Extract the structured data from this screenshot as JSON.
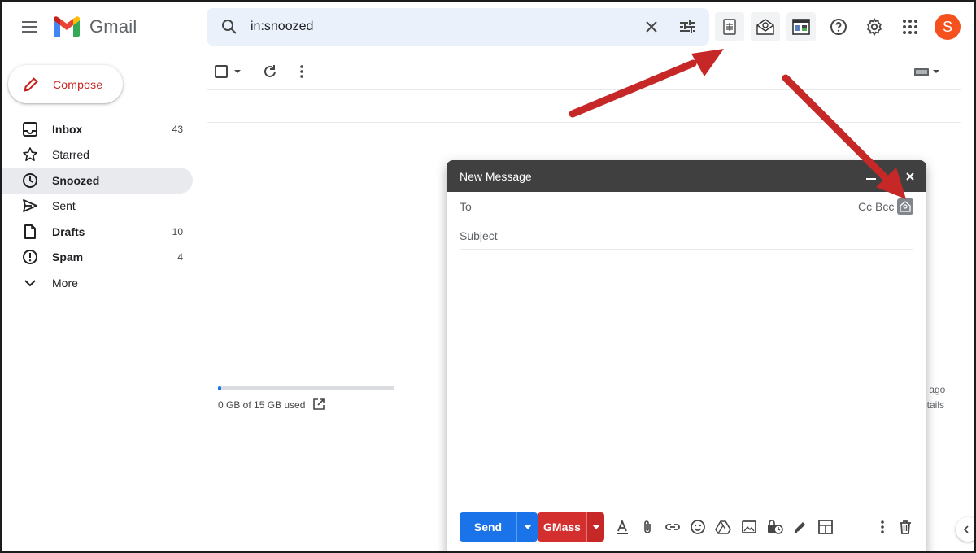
{
  "app": {
    "name": "Gmail"
  },
  "search": {
    "query": "in:snoozed"
  },
  "compose_button": {
    "label": "Compose"
  },
  "nav": [
    {
      "label": "Inbox",
      "count": "43",
      "icon": "inbox-icon",
      "bold": true
    },
    {
      "label": "Starred",
      "count": "",
      "icon": "star-icon",
      "bold": false
    },
    {
      "label": "Snoozed",
      "count": "",
      "icon": "clock-icon",
      "bold": true,
      "active": true
    },
    {
      "label": "Sent",
      "count": "",
      "icon": "send-icon",
      "bold": false
    },
    {
      "label": "Drafts",
      "count": "10",
      "icon": "draft-icon",
      "bold": true
    },
    {
      "label": "Spam",
      "count": "4",
      "icon": "spam-icon",
      "bold": true
    },
    {
      "label": "More",
      "count": "",
      "icon": "chevron-down-icon",
      "bold": false
    }
  ],
  "user": {
    "avatar_letter": "S"
  },
  "storage": {
    "text": "0 GB of 15 GB used",
    "fraction_used": 0.02
  },
  "peek": {
    "line1": "s ago",
    "line2": "etails"
  },
  "compose_window": {
    "title": "New Message",
    "to_label": "To",
    "cc_bcc": "Cc Bcc",
    "subject_label": "Subject",
    "send_label": "Send",
    "gmass_label": "GMass"
  },
  "colors": {
    "compose_text": "#c5221f",
    "send_button": "#1a73e8",
    "gmass_button": "#d32f2f",
    "annotation_arrow": "#c62828",
    "avatar": "#f4511e"
  }
}
